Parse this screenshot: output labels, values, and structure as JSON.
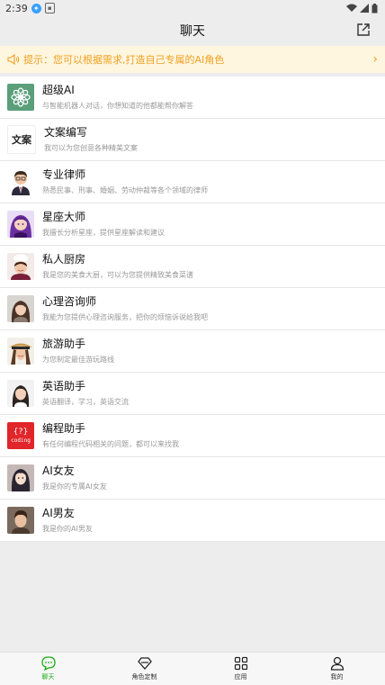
{
  "status_bar": {
    "time": "2:39"
  },
  "header": {
    "title": "聊天"
  },
  "notice": {
    "text": "提示：您可以根据需求,打造自己专属的AI角色"
  },
  "roles": [
    {
      "name": "超级AI",
      "desc": "与智能机器人对话，你想知道的他都能帮你解答"
    },
    {
      "name": "文案编写",
      "desc": "我可以为您创意各种精美文案"
    },
    {
      "name": "专业律师",
      "desc": "熟悉民事、刑事、婚姻、劳动仲裁等各个领域的律师"
    },
    {
      "name": "星座大师",
      "desc": "我擅长分析星座，提供星座解读和建议"
    },
    {
      "name": "私人厨房",
      "desc": "我是您的美食大厨，可以为您提供精致美食菜谱"
    },
    {
      "name": "心理咨询师",
      "desc": "我能为您提供心理咨询服务，把你的烦恼诉说给我吧"
    },
    {
      "name": "旅游助手",
      "desc": "为您制定最佳游玩路线"
    },
    {
      "name": "英语助手",
      "desc": "英语翻译，学习，英语交流"
    },
    {
      "name": "编程助手",
      "desc": "有任何编程代码相关的问题，都可以来找我"
    },
    {
      "name": "AI女友",
      "desc": "我是你的专属AI女友"
    },
    {
      "name": "AI男友",
      "desc": "我是你的AI男友"
    }
  ],
  "avatar_text": {
    "wenan": "文案",
    "coding_top": "{?}",
    "coding_bottom": "coding"
  },
  "tabs": [
    {
      "label": "聊天",
      "icon": "chat-bubble-icon",
      "active": true
    },
    {
      "label": "角色定制",
      "icon": "diamond-icon",
      "active": false
    },
    {
      "label": "应用",
      "icon": "grid-icon",
      "active": false
    },
    {
      "label": "我的",
      "icon": "person-icon",
      "active": false
    }
  ],
  "colors": {
    "accent": "#1aad19",
    "notice_text": "#f0a020",
    "notice_bg": "#fff6e0"
  }
}
